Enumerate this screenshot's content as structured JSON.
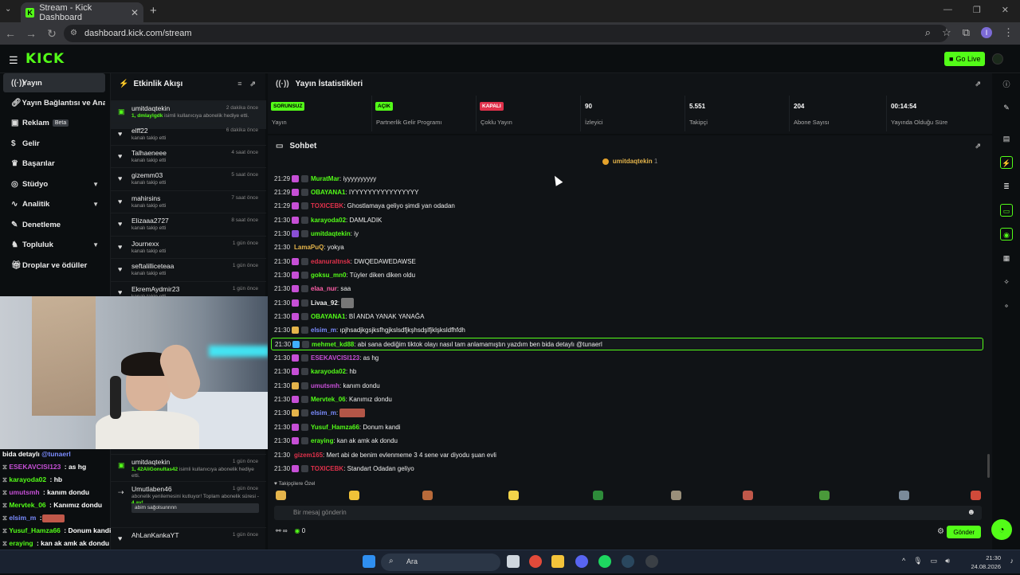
{
  "browser": {
    "tab_title": "Stream - Kick Dashboard",
    "url": "dashboard.kick.com/stream",
    "profile_initial": "I"
  },
  "topbar": {
    "logo": "KICK",
    "go_live": "Go Live"
  },
  "sidebar": {
    "items": [
      {
        "label": "Yayın",
        "icon": "broadcast-icon"
      },
      {
        "label": "Yayın Bağlantısı ve Anahtarı",
        "icon": "link-icon"
      },
      {
        "label": "Reklam",
        "icon": "ad-icon",
        "badge": "Beta"
      },
      {
        "label": "Gelir",
        "icon": "money-icon"
      },
      {
        "label": "Başarılar",
        "icon": "trophy-icon"
      },
      {
        "label": "Stüdyo",
        "icon": "studio-icon"
      },
      {
        "label": "Analitik",
        "icon": "analytics-icon"
      },
      {
        "label": "Denetleme",
        "icon": "moderation-icon"
      },
      {
        "label": "Topluluk",
        "icon": "community-icon"
      },
      {
        "label": "Droplar ve ödüller",
        "icon": "drops-icon"
      }
    ]
  },
  "feed": {
    "title": "Etkinlik Akışı",
    "items": [
      {
        "name": "umitdaqtekin",
        "time": "2 dakika önce",
        "desc_hl": "1, dmlaylgdk",
        "desc": " isimli kullanıcıya abonelik hediye etti."
      },
      {
        "name": "elff22",
        "time": "6 dakika önce",
        "desc": "kanalı takip etti"
      },
      {
        "name": "Talhaeneee",
        "time": "4 saat önce",
        "desc": "kanalı takip etti"
      },
      {
        "name": "gizemm03",
        "time": "5 saat önce",
        "desc": "kanalı takip etti"
      },
      {
        "name": "mahirsins",
        "time": "7 saat önce",
        "desc": "kanalı takip etti"
      },
      {
        "name": "Elizaaa2727",
        "time": "8 saat önce",
        "desc": "kanalı takip etti"
      },
      {
        "name": "Journexx",
        "time": "1 gün önce",
        "desc": "kanalı takip etti"
      },
      {
        "name": "seftalilliceteaa",
        "time": "1 gün önce",
        "desc": "kanalı takip etti"
      },
      {
        "name": "EkremAydmir23",
        "time": "1 gün önce",
        "desc": "kanalı takip etti"
      }
    ],
    "items_lower": [
      {
        "name": "umitdaqtekin",
        "time": "1 gün önce",
        "desc_hl": "1, 42AliGonultas42",
        "desc": " isimli kullanıcıya abonelik hediye etti."
      },
      {
        "name": "Umutlaben46",
        "time": "1 gün önce",
        "desc": "abonelik yenilemesini kutluyor! Toplam abonelik süresi - ",
        "desc_hl": "4 ay!",
        "message": "abim sağolsunnnn"
      },
      {
        "name": "AhLanKankaYT",
        "time": "1 gün önce",
        "desc": ""
      }
    ]
  },
  "stats": {
    "title": "Yayın İstatistikleri",
    "cells": [
      {
        "badge": "SORUNSUZ",
        "label": "Yayın"
      },
      {
        "badge": "AÇIK",
        "label": "Partnerlik Gelir Programı"
      },
      {
        "badge": "KAPALI",
        "label": "Çoklu Yayın"
      },
      {
        "value": "90",
        "label": "İzleyici"
      },
      {
        "value": "5.551",
        "label": "Takipçi"
      },
      {
        "value": "204",
        "label": "Abone Sayısı"
      },
      {
        "value": "00:14:54",
        "label": "Yayında Olduğu Süre"
      }
    ]
  },
  "chat": {
    "title": "Sohbet",
    "pinned_user": "umitdaqtekin",
    "pinned_count": "1",
    "messages": [
      {
        "time": "21:29",
        "name": "MuratMar",
        "text": ": iyyyyyyyyyy",
        "color": "#53fc18",
        "badge": "#c64fd6"
      },
      {
        "time": "21:29",
        "name": "OBAYANA1",
        "text": ": IYYYYYYYYYYYYYYYY",
        "color": "#53fc18",
        "badge": "#c64fd6"
      },
      {
        "time": "21:29",
        "name": "TOXICEBK",
        "text": ": Ghostlamaya geliyo şimdi yan odadan",
        "color": "#e0314b",
        "badge": "#c64fd6"
      },
      {
        "time": "21:30",
        "name": "karayoda02",
        "text": ": DAMLADIK",
        "color": "#53fc18",
        "badge": "#c64fd6"
      },
      {
        "time": "21:30",
        "name": "umitdaqtekin",
        "text": ": iy",
        "color": "#53fc18",
        "badge": "#8a4fd6"
      },
      {
        "time": "21:30",
        "name": "LamaPuQ",
        "text": ": yokya",
        "color": "#e4b44b",
        "badge": ""
      },
      {
        "time": "21:30",
        "name": "edanuraltnsk",
        "text": ": DWQEDAWEDAWSE",
        "color": "#e0314b",
        "badge": "#c64fd6"
      },
      {
        "time": "21:30",
        "name": "goksu_mn0",
        "text": ": Tüyler diken diken oldu",
        "color": "#53fc18",
        "badge": "#c64fd6"
      },
      {
        "time": "21:30",
        "name": "elaa_nur",
        "text": ": saa",
        "color": "#ff5fa8",
        "badge": "#c64fd6"
      },
      {
        "time": "21:30",
        "name": "Livaa_92",
        "text": ":",
        "color": "#eeeeee",
        "badge": "#c64fd6",
        "img": "gray"
      },
      {
        "time": "21:30",
        "name": "OBAYANA1",
        "text": ": Bİ ANDA YANAK YANAĞA",
        "color": "#53fc18",
        "badge": "#c64fd6"
      },
      {
        "time": "21:30",
        "name": "elsim_m",
        "text": ": ıpjhsadjkgsjksfhgjkslsdfjkşhsdşlfjklşksldfhfdh",
        "color": "#7b8cff",
        "badge": "#e4b44b"
      },
      {
        "time": "21:30",
        "name": "mehmet_kd88",
        "text": ": abi sana dediğim tiktok olayı nasıl tam anlamamıştın yazdım ben bida detaylı @tunaerl",
        "color": "#53fc18",
        "badge": "#3fb0ff",
        "hl": true
      },
      {
        "time": "21:30",
        "name": "ESEKAVCISI123",
        "text": ": as hg",
        "color": "#c64fd6",
        "badge": "#c64fd6"
      },
      {
        "time": "21:30",
        "name": "karayoda02",
        "text": ": hb",
        "color": "#53fc18",
        "badge": "#c64fd6"
      },
      {
        "time": "21:30",
        "name": "umutsmh",
        "text": ": kanım dondu",
        "color": "#c64fd6",
        "badge": "#e4b44b"
      },
      {
        "time": "21:30",
        "name": "Mervtek_06",
        "text": ": Kanımız dondu",
        "color": "#53fc18",
        "badge": "#c64fd6"
      },
      {
        "time": "21:30",
        "name": "elsim_m",
        "text": ":",
        "color": "#7b8cff",
        "badge": "#e4b44b",
        "img": "red"
      },
      {
        "time": "21:30",
        "name": "Yusuf_Hamza66",
        "text": ": Donum kandi",
        "color": "#53fc18",
        "badge": "#c64fd6"
      },
      {
        "time": "21:30",
        "name": "eraying",
        "text": ": kan ak amk ak dondu",
        "color": "#53fc18",
        "badge": "#c64fd6"
      },
      {
        "time": "21:30",
        "name": "gizem165",
        "text": ": Mert abi de benim evlenmeme 3 4 sene var diyodu şuan evli",
        "color": "#e0314b",
        "badge": ""
      },
      {
        "time": "21:30",
        "name": "TOXICEBK",
        "text": ": Standart Odadan geliyo",
        "color": "#e0314b",
        "badge": "#c64fd6"
      }
    ],
    "sub_only": "Takipçilere Özel",
    "placeholder": "Bir mesaj gönderin",
    "footer_count": "0",
    "send": "Gönder"
  },
  "overlay_chat": [
    {
      "name": "",
      "text": "bida detaylı ",
      "mention": "@tunaerl"
    },
    {
      "name": "ESEKAVCISI123",
      "text": " : as hg",
      "color": "#c64fd6"
    },
    {
      "name": "karayoda02",
      "text": " : hb",
      "color": "#53fc18"
    },
    {
      "name": "umutsmh",
      "text": " : kanım dondu",
      "color": "#c64fd6"
    },
    {
      "name": "Mervtek_06",
      "text": " : Kanımız dondu",
      "color": "#53fc18"
    },
    {
      "name": "elsim_m",
      "text": " :",
      "color": "#7b8cff",
      "img": true
    },
    {
      "name": "Yusuf_Hamza66",
      "text": " : Donum kandi",
      "color": "#53fc18"
    },
    {
      "name": "eraying",
      "text": " : kan ak amk ak dondu",
      "color": "#53fc18"
    },
    {
      "name": "gizem165",
      "text": " : Mert abi de benim evlenmeme 3 4 sene var diyodu şuan evli",
      "color": "#e0314b"
    },
    {
      "name": "TOXICEBK",
      "text": " : Standart Odadan geliyo",
      "color": "#e0314b"
    }
  ],
  "taskbar": {
    "search": "Ara",
    "time": "21:30",
    "date": "24.08.2026"
  },
  "colors": {
    "accent": "#53fc18",
    "panel": "#101316",
    "bg": "#0b0e10"
  }
}
